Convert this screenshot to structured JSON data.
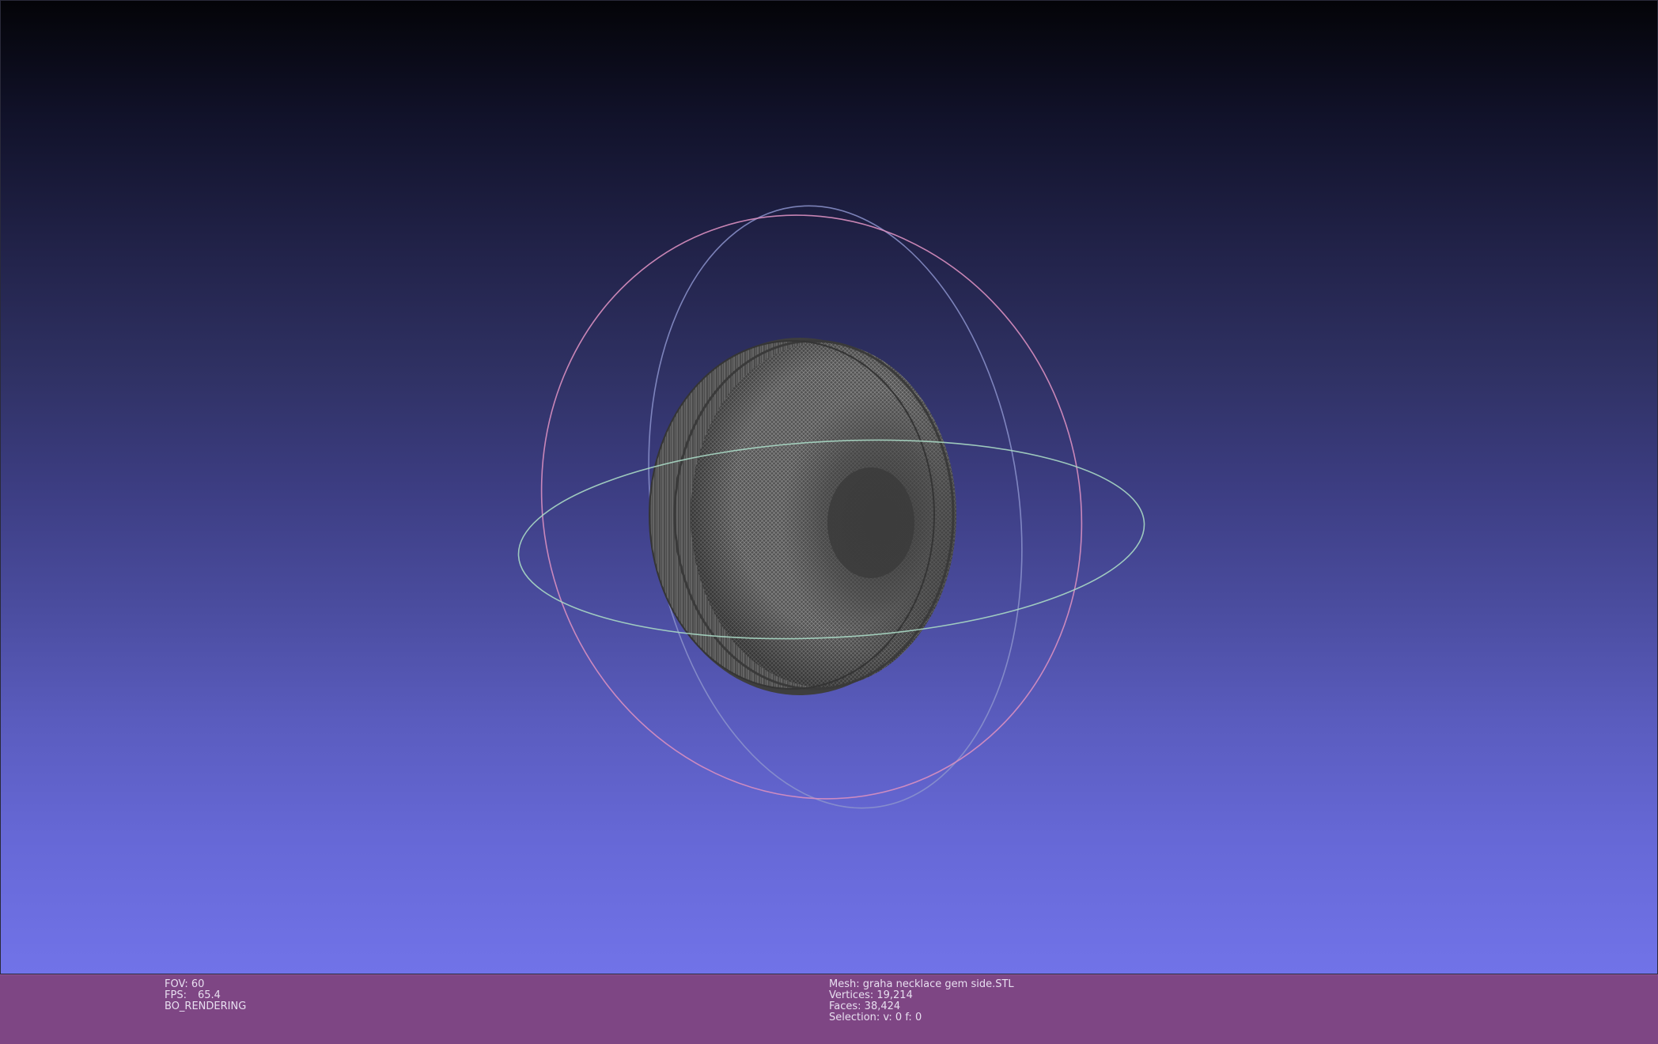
{
  "viewport": {
    "background_top": "#040408",
    "background_bottom": "#7173e8"
  },
  "overlay_left": {
    "fov_label": "FOV: 60",
    "fps_label": "FPS:",
    "fps_value": "65.4",
    "render_mode": "BO_RENDERING"
  },
  "overlay_right": {
    "mesh": "Mesh: graha necklace gem side.STL",
    "vertices": "Vertices: 19,214",
    "faces": "Faces: 38,424",
    "selection": "Selection: v: 0 f: 0"
  },
  "colors": {
    "info_bar": "#7e4684",
    "mesh_fill": "#4a4a4a",
    "trackball_x": "#e08fbf",
    "trackball_y": "#9aa0d8",
    "trackball_z": "#a8d8c0"
  }
}
